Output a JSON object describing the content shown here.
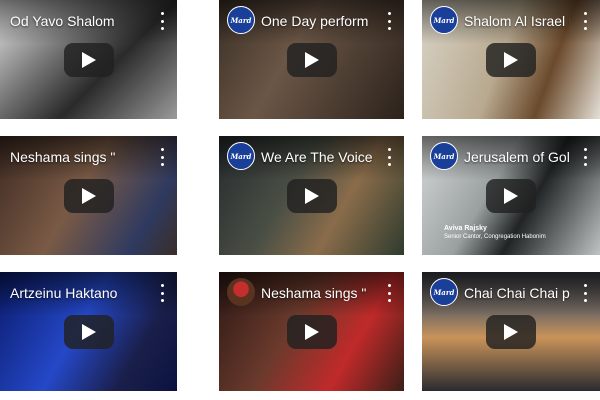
{
  "videos": [
    {
      "title": "Od Yavo Shalom",
      "channel_icon": "none",
      "bg": "linear-gradient(135deg,#e8e8e8 0%,#777 35%,#2a2a2a 60%,#9a9a9a 100%)"
    },
    {
      "title": "One Day perform",
      "channel_icon": "mard-logo",
      "logo_text": "Mard",
      "bg": "linear-gradient(120deg,#3a2f26 0%,#6b5646 40%,#2b221b 100%)"
    },
    {
      "title": "Shalom Al Israel p",
      "channel_icon": "mard-logo",
      "logo_text": "Mard",
      "bg": "linear-gradient(110deg,#d8d3c6 0%,#b8a98f 45%,#6b4a2c 70%,#e4e0d6 100%)"
    },
    {
      "title": "Neshama sings \"",
      "channel_icon": "none",
      "bg": "linear-gradient(120deg,#3d2a22 0%,#7a5a45 45%,#2f3a60 80%,#3a2d28 100%)"
    },
    {
      "title": "We Are The Voice",
      "channel_icon": "mard-logo",
      "logo_text": "Mard",
      "bg": "linear-gradient(120deg,#262a2d 0%,#4a4f45 40%,#8a6c4a 65%,#2e3b2e 100%)"
    },
    {
      "title": "Jerusalem of Gol",
      "channel_icon": "mard-logo",
      "logo_text": "Mard",
      "bg": "linear-gradient(120deg,#d6d8d8 0%,#9aa0a0 40%,#202424 60%,#bfc3c3 100%)",
      "caption_name": "Aviva Rajsky",
      "caption_role": "Senior Cantor, Congregation Habonim"
    },
    {
      "title": "Artzeinu Haktano",
      "channel_icon": "none",
      "bg": "linear-gradient(120deg,#0a1b6b 0%,#2548c8 45%,#1a1f4a 75%,#0c1240 100%)"
    },
    {
      "title": "Neshama sings \"",
      "channel_icon": "avatar",
      "bg": "linear-gradient(120deg,#2c1814 0%,#6a3a2c 40%,#c02a2a 70%,#3a1f18 100%)"
    },
    {
      "title": "Chai Chai Chai pe",
      "channel_icon": "mard-logo",
      "logo_text": "Mard",
      "bg": "linear-gradient(180deg,#3a3b42 0%,#7a6e63 35%,#c9935a 55%,#2a2b30 100%)"
    }
  ],
  "icons": {
    "play": "play-icon",
    "menu": "more-vert-icon"
  },
  "colors": {
    "play_button": "#212121",
    "logo_blue": "#1a3f99"
  }
}
